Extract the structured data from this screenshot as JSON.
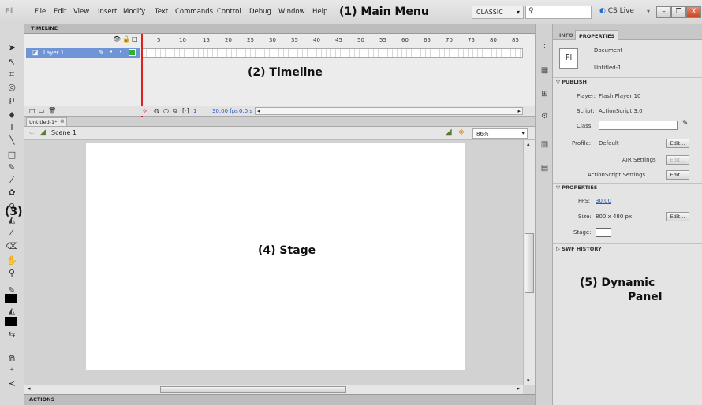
{
  "app_logo": "Fl",
  "menu": {
    "items": [
      "File",
      "Edit",
      "View",
      "Insert",
      "Modify",
      "Text",
      "Commands",
      "Control",
      "Debug",
      "Window",
      "Help"
    ],
    "workspace": "CLASSIC",
    "cs_live": "CS Live",
    "window_buttons": [
      "–",
      "❐",
      "X"
    ]
  },
  "timeline": {
    "tab_label": "TIMELINE",
    "frame_numbers": [
      "5",
      "10",
      "15",
      "20",
      "25",
      "30",
      "35",
      "40",
      "45",
      "50",
      "55",
      "60",
      "65",
      "70",
      "75",
      "80",
      "85"
    ],
    "layer_name": "Layer 1",
    "status_frame": "1",
    "status_fps": "30.00 fps",
    "status_time": "0.0 s"
  },
  "document": {
    "tab_label": "Untitled-1*",
    "scene_label": "Scene 1",
    "zoom": "86%"
  },
  "actions_label": "ACTIONS",
  "properties": {
    "tabs": [
      "INFO",
      "PROPERTIES"
    ],
    "doc_type": "Document",
    "doc_name": "Untitled-1",
    "fl_icon": "Fl",
    "publish_header": "PUBLISH",
    "player_label": "Player:",
    "player_value": "Flash Player 10",
    "script_label": "Script:",
    "script_value": "ActionScript 3.0",
    "class_label": "Class:",
    "profile_label": "Profile:",
    "profile_value": "Default",
    "edit_label": "Edit...",
    "air_settings": "AIR Settings",
    "as_settings": "ActionScript Settings",
    "properties_header": "PROPERTIES",
    "fps_label": "FPS:",
    "fps_value": "30.00",
    "size_label": "Size:",
    "size_value": "800 x 480 px",
    "stage_label": "Stage:",
    "swf_history": "SWF HISTORY"
  },
  "annotations": {
    "main_menu": "(1) Main Menu",
    "timeline": "(2) Timeline",
    "tool_bar": "(3) Tool Bar",
    "stage": "(4) Stage",
    "dynamic_panel_line1": "(5) Dynamic",
    "dynamic_panel_line2": "Panel"
  },
  "tools": [
    "selection-tool-icon",
    "subselection-tool-icon",
    "free-transform-tool-icon",
    "3d-rotation-tool-icon",
    "lasso-tool-icon",
    "pen-tool-icon",
    "text-tool-icon",
    "line-tool-icon",
    "rectangle-tool-icon",
    "pencil-tool-icon",
    "brush-tool-icon",
    "deco-tool-icon",
    "bone-tool-icon",
    "paint-bucket-tool-icon",
    "eyedropper-tool-icon",
    "eraser-tool-icon",
    "hand-tool-icon",
    "zoom-tool-icon",
    "stroke-color-icon",
    "fill-color-icon"
  ],
  "colors": {
    "layer_highlight": "#6f95d6",
    "playhead": "#e02020",
    "stage": "#ffffff",
    "pasteboard": "#d2d2d2"
  }
}
